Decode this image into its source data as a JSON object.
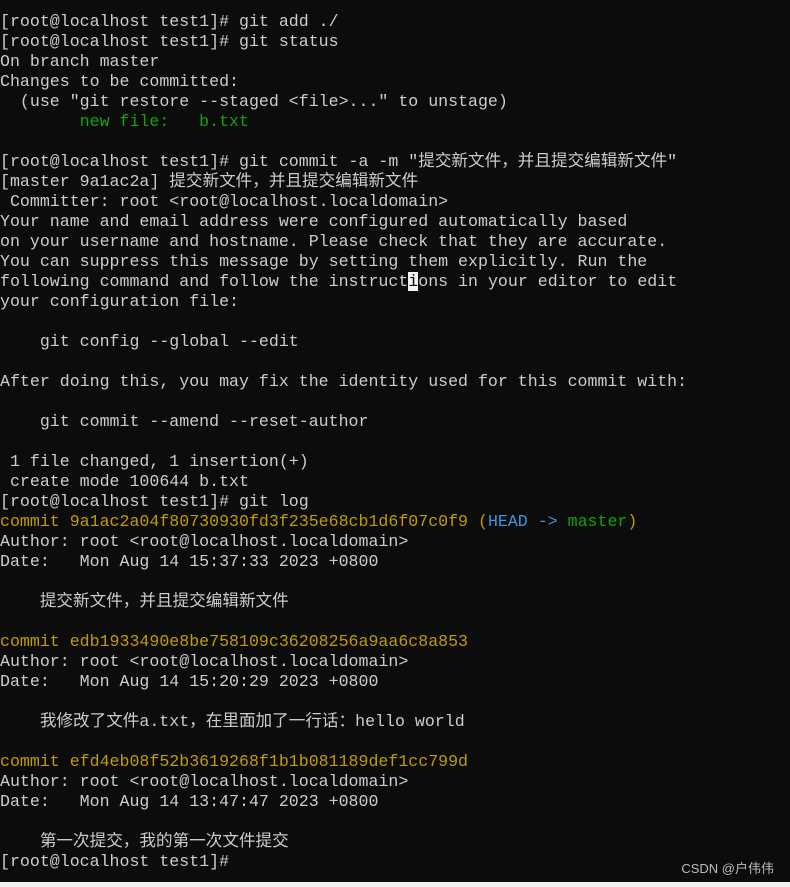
{
  "colors": {
    "default": "#cccccc",
    "yellow": "#c19c00",
    "green": "#13a10e",
    "cyan": "#3a96dd",
    "background": "#0c0c0c"
  },
  "terminal": {
    "lines": [
      [
        {
          "t": "[root@localhost test1]# git add ./"
        }
      ],
      [
        {
          "t": "[root@localhost test1]# git status"
        }
      ],
      [
        {
          "t": "On branch master"
        }
      ],
      [
        {
          "t": "Changes to be committed:"
        }
      ],
      [
        {
          "t": "  (use \"git restore --staged <file>...\" to unstage)"
        }
      ],
      [
        {
          "t": "        "
        },
        {
          "t": "new file:   b.txt",
          "c": "green"
        }
      ],
      [
        {
          "t": ""
        }
      ],
      [
        {
          "t": "[root@localhost test1]# git commit -a -m \"提交新文件，并且提交编辑新文件\""
        }
      ],
      [
        {
          "t": "[master 9a1ac2a] 提交新文件，并且提交编辑新文件"
        }
      ],
      [
        {
          "t": " Committer: root <root@localhost.localdomain>"
        }
      ],
      [
        {
          "t": "Your name and email address were configured automatically based"
        }
      ],
      [
        {
          "t": "on your username and hostname. Please check that they are accurate."
        }
      ],
      [
        {
          "t": "You can suppress this message by setting them explicitly. Run the"
        }
      ],
      [
        {
          "t": "following command and follow the instruct"
        },
        {
          "t": "i",
          "c": "cursor"
        },
        {
          "t": "ons in your editor to edit"
        }
      ],
      [
        {
          "t": "your configuration file:"
        }
      ],
      [
        {
          "t": ""
        }
      ],
      [
        {
          "t": "    git config --global --edit"
        }
      ],
      [
        {
          "t": ""
        }
      ],
      [
        {
          "t": "After doing this, you may fix the identity used for this commit with:"
        }
      ],
      [
        {
          "t": ""
        }
      ],
      [
        {
          "t": "    git commit --amend --reset-author"
        }
      ],
      [
        {
          "t": ""
        }
      ],
      [
        {
          "t": " 1 file changed, 1 insertion(+)"
        }
      ],
      [
        {
          "t": " create mode 100644 b.txt"
        }
      ],
      [
        {
          "t": "[root@localhost test1]# git log"
        }
      ],
      [
        {
          "t": "commit 9a1ac2a04f80730930fd3f235e68cb1d6f07c0f9 (",
          "c": "yellow"
        },
        {
          "t": "HEAD -> ",
          "c": "cyan"
        },
        {
          "t": "master",
          "c": "green"
        },
        {
          "t": ")",
          "c": "yellow"
        }
      ],
      [
        {
          "t": "Author: root <root@localhost.localdomain>"
        }
      ],
      [
        {
          "t": "Date:   Mon Aug 14 15:37:33 2023 +0800"
        }
      ],
      [
        {
          "t": ""
        }
      ],
      [
        {
          "t": "    提交新文件，并且提交编辑新文件"
        }
      ],
      [
        {
          "t": ""
        }
      ],
      [
        {
          "t": "commit edb1933490e8be758109c36208256a9aa6c8a853",
          "c": "yellow"
        }
      ],
      [
        {
          "t": "Author: root <root@localhost.localdomain>"
        }
      ],
      [
        {
          "t": "Date:   Mon Aug 14 15:20:29 2023 +0800"
        }
      ],
      [
        {
          "t": ""
        }
      ],
      [
        {
          "t": "    我修改了文件a.txt，在里面加了一行话：hello world"
        }
      ],
      [
        {
          "t": ""
        }
      ],
      [
        {
          "t": "commit efd4eb08f52b3619268f1b1b081189def1cc799d",
          "c": "yellow"
        }
      ],
      [
        {
          "t": "Author: root <root@localhost.localdomain>"
        }
      ],
      [
        {
          "t": "Date:   Mon Aug 14 13:47:47 2023 +0800"
        }
      ],
      [
        {
          "t": ""
        }
      ],
      [
        {
          "t": "    第一次提交，我的第一次文件提交"
        }
      ],
      [
        {
          "t": "[root@localhost test1]# "
        }
      ]
    ]
  },
  "watermark": "CSDN @户伟伟"
}
